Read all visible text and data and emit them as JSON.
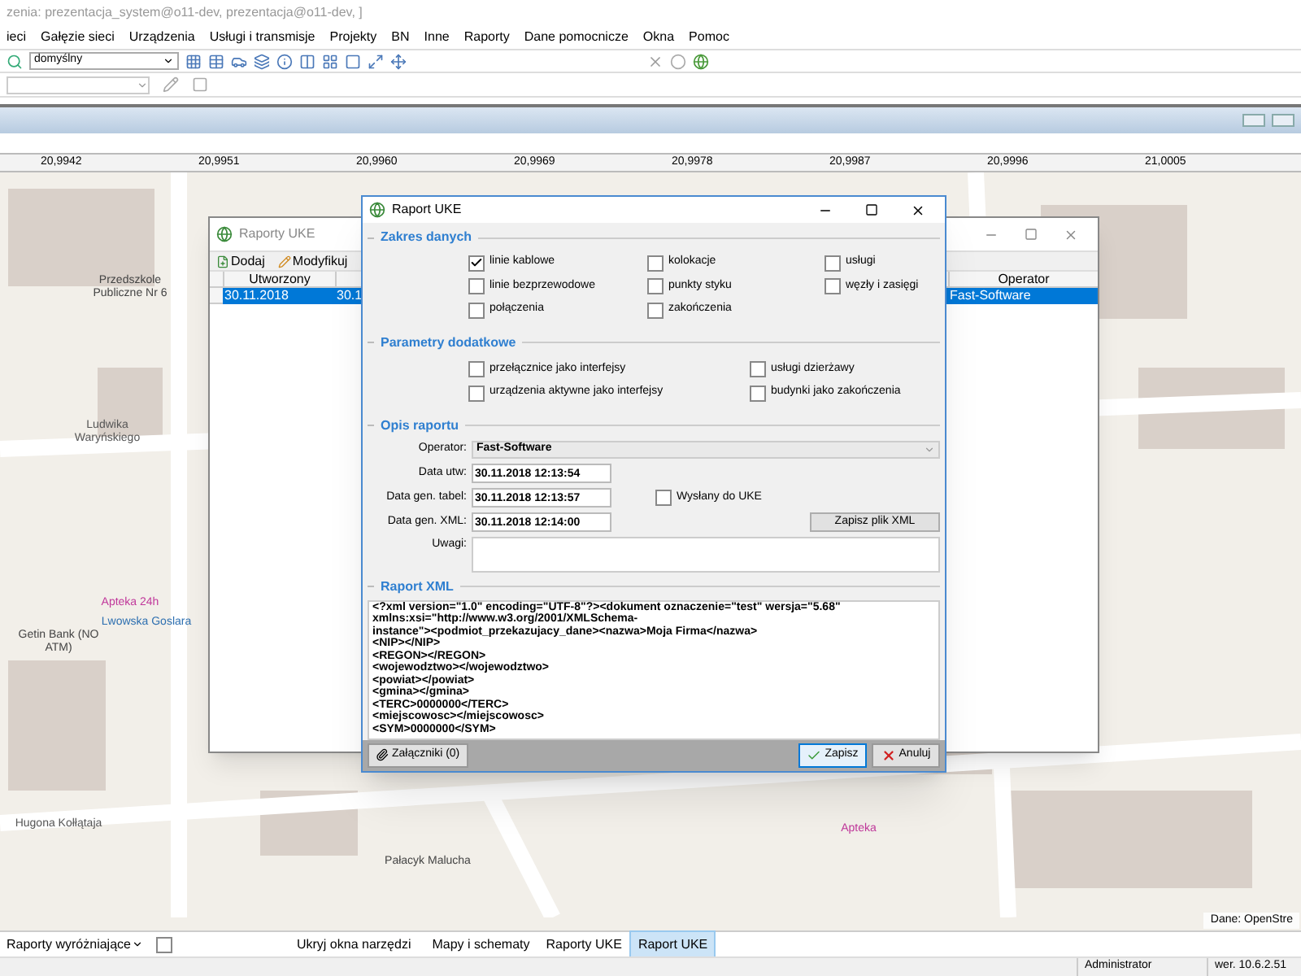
{
  "app_title": "zenia: prezentacja_system@o11-dev, prezentacja@o11-dev, ]",
  "menu": [
    "ieci",
    "Gałęzie sieci",
    "Urządzenia",
    "Usługi i transmisje",
    "Projekty",
    "BN",
    "Inne",
    "Raporty",
    "Dane pomocnicze",
    "Okna",
    "Pomoc"
  ],
  "style_select": {
    "value": "domyślny"
  },
  "ruler": [
    "20,9942",
    "20,9951",
    "20,9960",
    "20,9969",
    "20,9978",
    "20,9987",
    "20,9996",
    "21,0005"
  ],
  "map_labels": [
    {
      "text": "Przedszkole Publiczne Nr 6",
      "kind": "poi"
    },
    {
      "text": "Ludwika Waryńskiego",
      "kind": "street"
    },
    {
      "text": "Getin Bank (NO ATM)",
      "kind": "poi"
    },
    {
      "text": "Apteka 24h",
      "kind": "pharmacy"
    },
    {
      "text": "Lwowska Goslara",
      "kind": "stop"
    },
    {
      "text": "Pałacyk Malucha",
      "kind": "poi"
    },
    {
      "text": "Hugona Kołłątaja",
      "kind": "street"
    },
    {
      "text": "Apteka",
      "kind": "pharmacy"
    }
  ],
  "attribution": "Dane: OpenStre",
  "list_window": {
    "title": "Raporty UKE",
    "toolbar": [
      "Dodaj",
      "Modyfikuj"
    ],
    "columns": [
      "Utworzony",
      "",
      "Operator"
    ],
    "rows": [
      {
        "cells": [
          "30.11.2018",
          "30.1",
          "Fast-Software"
        ],
        "selected": true
      }
    ]
  },
  "dialog": {
    "title": "Raport UKE",
    "scope_title": "Zakres danych",
    "scope": [
      {
        "label": "linie kablowe",
        "checked": true
      },
      {
        "label": "kolokacje",
        "checked": false
      },
      {
        "label": "usługi",
        "checked": false
      },
      {
        "label": "linie bezprzewodowe",
        "checked": false
      },
      {
        "label": "punkty styku",
        "checked": false
      },
      {
        "label": "węzły i zasięgi",
        "checked": false
      },
      {
        "label": "połączenia",
        "checked": false
      },
      {
        "label": "zakończenia",
        "checked": false
      }
    ],
    "params_title": "Parametry dodatkowe",
    "params": [
      {
        "label": "przełącznice jako interfejsy",
        "checked": false
      },
      {
        "label": "usługi dzierżawy",
        "checked": false
      },
      {
        "label": "urządzenia aktywne jako interfejsy",
        "checked": false
      },
      {
        "label": "budynki jako zakończenia",
        "checked": false
      }
    ],
    "desc_title": "Opis raportu",
    "operator": {
      "label": "Operator:",
      "value": "Fast-Software"
    },
    "dates": [
      {
        "label": "Data utw:",
        "value": "30.11.2018 12:13:54"
      },
      {
        "label": "Data gen. tabel:",
        "value": "30.11.2018 12:13:57"
      },
      {
        "label": "Data gen. XML:",
        "value": "30.11.2018 12:14:00"
      }
    ],
    "sent": {
      "label": "Wysłany do UKE",
      "checked": false
    },
    "save_xml": "Zapisz plik XML",
    "notes_label": "Uwagi:",
    "xml_title": "Raport XML",
    "xml_lines": [
      "<?xml version=\"1.0\" encoding=\"UTF-8\"?><dokument oznaczenie=\"test\" wersja=\"5.68\"",
      "xmlns:xsi=\"http://www.w3.org/2001/XMLSchema-",
      "instance\"><podmiot_przekazujacy_dane><nazwa>Moja Firma</nazwa>",
      "<NIP></NIP>",
      "<REGON></REGON>",
      "<wojewodztwo></wojewodztwo>",
      "<powiat></powiat>",
      "<gmina></gmina>",
      "<TERC>0000000</TERC>",
      "<miejscowosc></miejscowosc>",
      "<SYM>0000000</SYM>"
    ],
    "attachments": "Załączniki (0)",
    "save": "Zapisz",
    "cancel": "Anuluj"
  },
  "bottom": {
    "dropdown": "Raporty wyróżniające",
    "toggle": {
      "checked": false
    },
    "hide_tools": "Ukryj okna narzędzi",
    "tabs": [
      {
        "label": "Mapy i schematy",
        "selected": false
      },
      {
        "label": "Raporty UKE",
        "selected": false
      },
      {
        "label": "Raport UKE",
        "selected": true
      }
    ]
  },
  "status": [
    "Administrator",
    "wer. 10.6.2.51"
  ]
}
